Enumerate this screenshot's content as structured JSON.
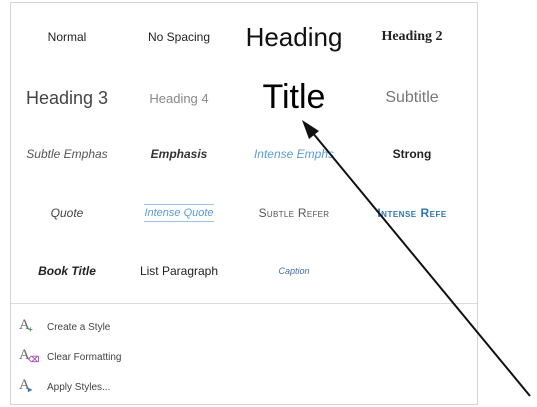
{
  "styles": {
    "row1": [
      "Normal",
      "No Spacing",
      "Heading",
      "Heading 2"
    ],
    "row2": [
      "Heading 3",
      "Heading 4",
      "Title",
      "Subtitle"
    ],
    "row3": [
      "Subtle Emphas",
      "Emphasis",
      "Intense Emphs",
      "Strong"
    ],
    "row4": [
      "Quote",
      "Intense Quote",
      "Subtle Refer",
      "Intense Refe"
    ],
    "row5": [
      "Book Title",
      "List Paragraph",
      "Caption"
    ]
  },
  "commands": {
    "create_style": "Create a Style",
    "clear_formatting": "Clear Formatting",
    "apply_styles": "Apply Styles..."
  },
  "colors": {
    "accent_blue": "#5b9bd5",
    "create_icon_accent": "#3aa04a",
    "clear_icon_accent": "#b04ac0",
    "apply_icon_accent": "#2e75b6"
  }
}
